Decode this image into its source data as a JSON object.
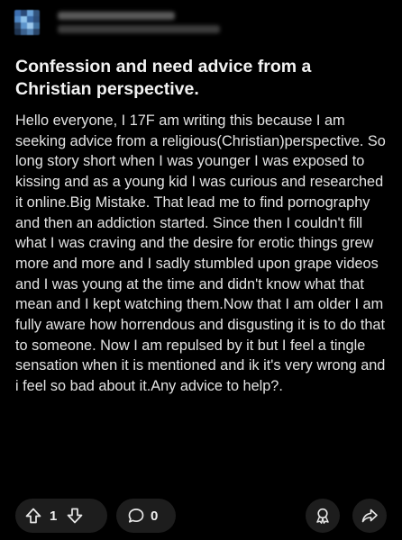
{
  "post": {
    "title": "Confession and need advice from a Christian perspective.",
    "body": "Hello everyone, I 17F am writing this because I am seeking advice from a religious(Christian)perspective. So long story short when I was younger I was exposed to kissing and as a young kid I was curious and researched it online.Big Mistake. That lead me to find pornography and then an addiction started. Since then I couldn't fill what I was craving and the desire for erotic things grew more and more and I sadly stumbled upon grape videos and I was young at the time and didn't know what that mean and I kept watching them.Now that I am older I am fully aware how horrendous and disgusting it is to do that to someone. Now I am repulsed by it but I feel a tingle sensation when it is mentioned and ik it's very wrong and i feel so bad about it.Any advice to help?."
  },
  "actions": {
    "upvote_icon": "upvote-arrow-icon",
    "downvote_icon": "downvote-arrow-icon",
    "comment_icon": "comment-bubble-icon",
    "award_icon": "award-ribbon-icon",
    "share_icon": "share-arrow-icon",
    "vote_count": "1",
    "comment_count": "0"
  },
  "colors": {
    "background": "#000000",
    "pill": "#1d1d1d",
    "text": "#e3e3e3"
  }
}
